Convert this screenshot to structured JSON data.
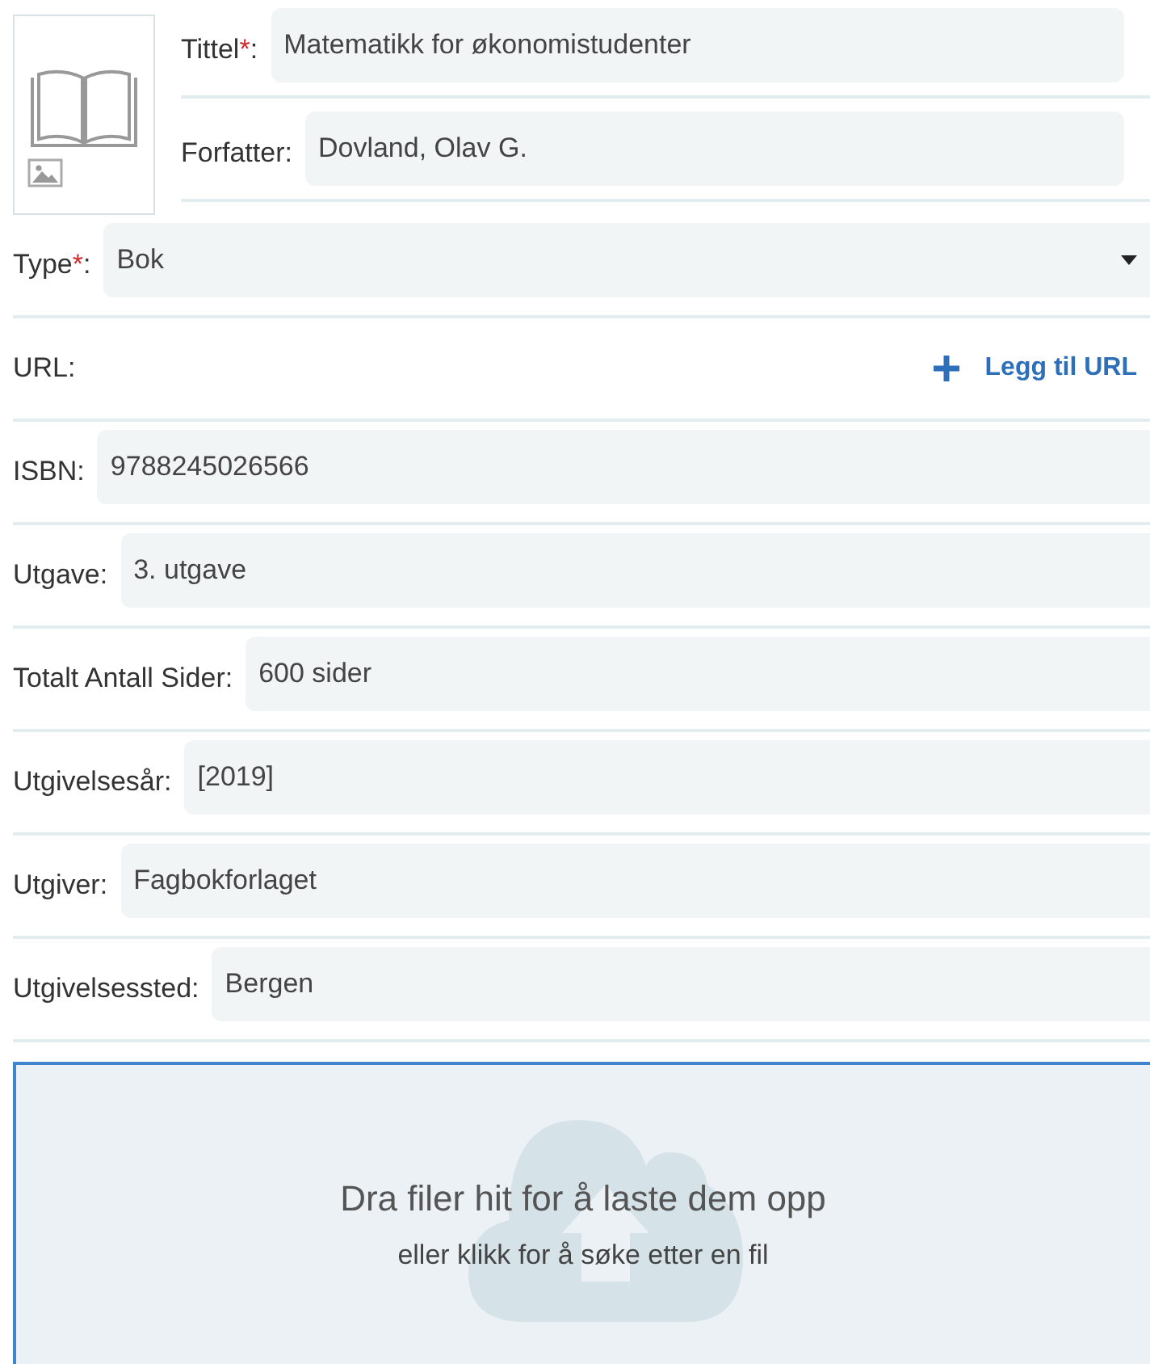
{
  "header_fields": [
    {
      "label": "Tittel",
      "required_mark": "*",
      "label_end": ":",
      "value": "Matematikk for økonomistudenter"
    },
    {
      "label": "Forfatter:",
      "value": "Dovland, Olav G."
    }
  ],
  "fields": [
    {
      "kind": "select",
      "label": "Type",
      "required_mark": "*",
      "label_end": ":",
      "value": "Bok"
    },
    {
      "kind": "link",
      "label": "URL:",
      "action": "Legg til URL"
    },
    {
      "kind": "text",
      "label": "ISBN:",
      "value": "9788245026566"
    },
    {
      "kind": "text",
      "label": "Utgave:",
      "value": "3. utgave"
    },
    {
      "kind": "text",
      "label": "Totalt Antall Sider:",
      "value": "600 sider"
    },
    {
      "kind": "text",
      "label": "Utgivelsesår:",
      "value": "[2019]"
    },
    {
      "kind": "text",
      "label": "Utgiver:",
      "value": "Fagbokforlaget"
    },
    {
      "kind": "text",
      "label": "Utgivelsessted:",
      "value": "Bergen"
    }
  ],
  "dropzone": {
    "title": "Dra filer hit for å laste dem opp",
    "subtitle": "eller klikk for å søke etter en fil"
  }
}
